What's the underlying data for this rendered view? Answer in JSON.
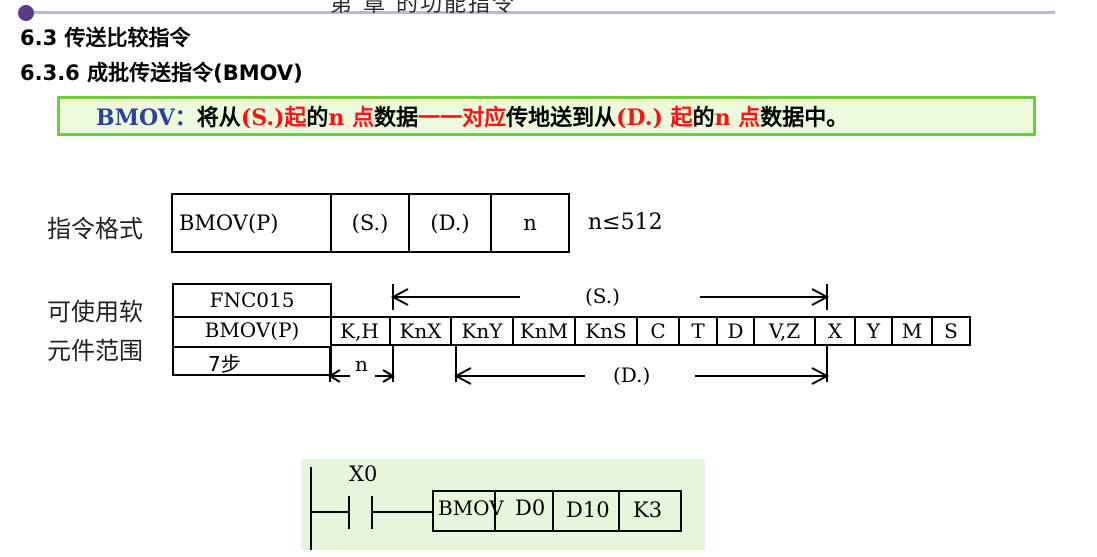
{
  "header": {
    "chapter_fragment": "第 章  的功能指令",
    "heading_section": "6.3 传送比较指令",
    "heading_subsection": "6.3.6 成批传送指令(BMOV)"
  },
  "note": {
    "part1": "BMOV：",
    "part2": "将从",
    "part3": "(S.)起",
    "part4": "的",
    "part5": "n 点",
    "part6": "数据",
    "part7": "一一对应",
    "part8": "传地送到从",
    "part9": "(D.) 起",
    "part10": "的",
    "part11": "n 点",
    "part12": "数据中。"
  },
  "format": {
    "label": "指令格式",
    "cells": [
      "BMOV(P)",
      "(S.)",
      "(D.)",
      "n"
    ],
    "limit": "n≤512"
  },
  "range": {
    "label_line1": "可使用软",
    "label_line2": "元件范围",
    "fnc": [
      "FNC015",
      "BMOV(P)",
      "7步"
    ],
    "devices": [
      "K,H",
      "KnX",
      "KnY",
      "KnM",
      "KnS",
      "C",
      "T",
      "D",
      "V,Z",
      "X",
      "Y",
      "M",
      "S"
    ],
    "s_label": "(S.)",
    "d_label": "(D.)",
    "n_label": "n"
  },
  "ladder": {
    "contact": "X0",
    "instruction": [
      "BMOV",
      "D0",
      "D10",
      "K3"
    ]
  },
  "colors": {
    "note_bg": "#eefadc",
    "note_border": "#6ccf3a",
    "accent_red": "#ff1111",
    "accent_blue": "#2d3fa0",
    "ladder_bg": "#e6f5dc"
  }
}
